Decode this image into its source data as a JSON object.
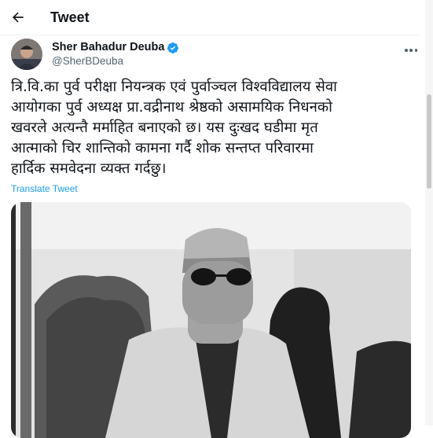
{
  "header": {
    "back_icon": "arrow-left-icon",
    "title": "Tweet"
  },
  "tweet": {
    "author": {
      "display_name": "Sher Bahadur Deuba",
      "handle": "@SherBDeuba",
      "verified_icon": "verified-badge-icon",
      "verified_color": "#1d9bf0"
    },
    "more_icon": "more-options-icon",
    "text_lines": [
      "त्रि.वि.का पुर्व परीक्षा नियन्त्रक एवं  पुर्वाञ्चल विश्वविद्यालय सेवा",
      "आयोगका पुर्व अध्यक्ष  प्रा.वद्रीनाथ श्रेष्ठको असामयिक निधनको",
      "खवरले अत्यन्तै मर्माहित बनाएको छ। यस दुःखद घडीमा मृत",
      "आत्माको चिर शान्तिको कामना गर्दै शोक सन्तप्त परिवारमा",
      "हार्दिक समवेदना व्यक्त गर्दछु।"
    ],
    "translate_label": "Translate Tweet",
    "accent_color": "#1d9bf0"
  }
}
